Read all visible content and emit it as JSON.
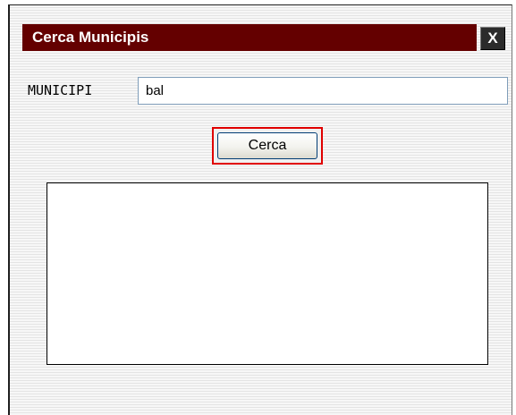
{
  "dialog": {
    "title": "Cerca Municipis",
    "close_label": "X"
  },
  "form": {
    "municipi_label": "MUNICIPI",
    "municipi_value": "bal",
    "search_button_label": "Cerca"
  },
  "results": {
    "items": []
  },
  "colors": {
    "titlebar": "#640000",
    "focus_border": "#e00000"
  }
}
